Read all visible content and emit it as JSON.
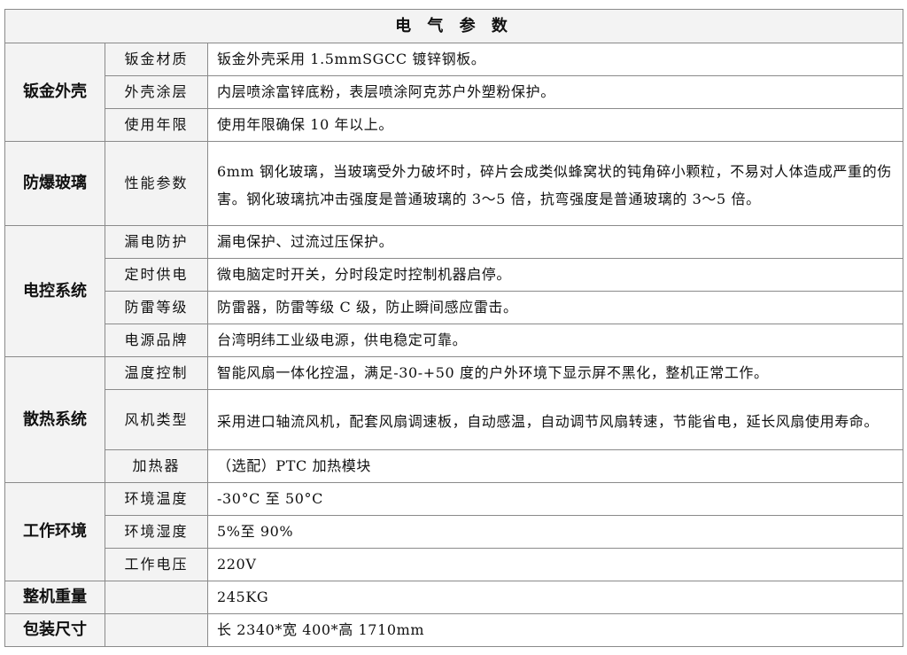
{
  "title": "电 气 参 数",
  "sections": [
    {
      "category": "钣金外壳",
      "rows": [
        {
          "label": "钣金材质",
          "value": "钣金外壳采用 1.5mmSGCC 镀锌钢板。"
        },
        {
          "label": "外壳涂层",
          "value": "内层喷涂富锌底粉，表层喷涂阿克苏户外塑粉保护。"
        },
        {
          "label": "使用年限",
          "value": "使用年限确保 10 年以上。"
        }
      ]
    },
    {
      "category": "防爆玻璃",
      "rows": [
        {
          "label": "性能参数",
          "value": "6mm 钢化玻璃，当玻璃受外力破坏时，碎片会成类似蜂窝状的钝角碎小颗粒，不易对人体造成严重的伤害。钢化玻璃抗冲击强度是普通玻璃的 3～5 倍，抗弯强度是普通玻璃的 3～5 倍。"
        }
      ]
    },
    {
      "category": "电控系统",
      "rows": [
        {
          "label": "漏电防护",
          "value": "漏电保护、过流过压保护。"
        },
        {
          "label": "定时供电",
          "value": "微电脑定时开关，分时段定时控制机器启停。"
        },
        {
          "label": "防雷等级",
          "value": "防雷器，防雷等级 C 级，防止瞬间感应雷击。"
        },
        {
          "label": "电源品牌",
          "value": "台湾明纬工业级电源，供电稳定可靠。"
        }
      ]
    },
    {
      "category": "散热系统",
      "rows": [
        {
          "label": "温度控制",
          "value": "智能风扇一体化控温，满足-30-+50 度的户外环境下显示屏不黑化，整机正常工作。"
        },
        {
          "label": "风机类型",
          "value": "采用进口轴流风机，配套风扇调速板，自动感温，自动调节风扇转速，节能省电，延长风扇使用寿命。"
        },
        {
          "label": "加热器",
          "value": "（选配）PTC 加热模块"
        }
      ]
    },
    {
      "category": "工作环境",
      "rows": [
        {
          "label": "环境温度",
          "value": "-30°C 至 50°C"
        },
        {
          "label": "环境湿度",
          "value": "5%至 90%"
        },
        {
          "label": "工作电压",
          "value": "220V"
        }
      ]
    },
    {
      "category": "整机重量",
      "rows": [
        {
          "label": "",
          "value": "245KG"
        }
      ]
    },
    {
      "category": "包装尺寸",
      "rows": [
        {
          "label": "",
          "value": "长 2340*宽 400*高 1710mm"
        }
      ]
    }
  ]
}
